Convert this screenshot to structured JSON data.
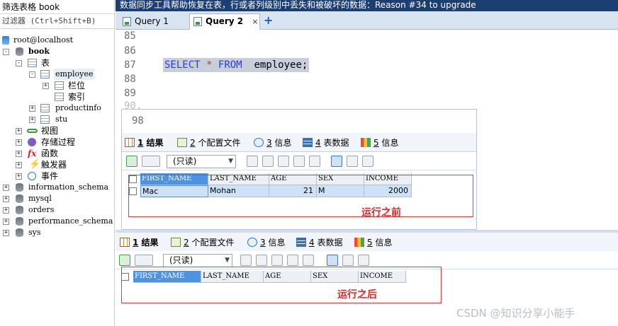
{
  "window": {
    "left_title": "筛选表格 book",
    "filter_placeholder": "过滤器 (Ctrl+Shift+B)",
    "top_message": "数据同步工具帮助恢复在表，行或者列级别中丢失和被破坏的数据：Reason #34 to upgrade"
  },
  "tree": {
    "connection": "root@localhost",
    "db_book": "book",
    "tables_folder": "表",
    "employee": "employee",
    "columns": "栏位",
    "indexes": "索引",
    "productinfo": "productinfo",
    "stu": "stu",
    "views": "视图",
    "procedures": "存储过程",
    "functions": "函数",
    "triggers": "触发器",
    "events": "事件",
    "other_dbs": [
      "information_schema",
      "mysql",
      "orders",
      "performance_schema",
      "sys"
    ]
  },
  "query_tabs": [
    {
      "label": "Query 1"
    },
    {
      "label": "Query 2",
      "close": "×"
    }
  ],
  "add_tab": "+",
  "editor": {
    "line_numbers": [
      "85",
      "86",
      "87",
      "88",
      "89",
      "90,",
      "98"
    ],
    "code": {
      "kw1": "SELECT",
      "star": "*",
      "kw2": "FROM",
      "rest": "  employee;"
    }
  },
  "result_tabs": [
    {
      "num": "1",
      "label": " 结果"
    },
    {
      "num": "2",
      "label": " 个配置文件"
    },
    {
      "num": "3",
      "label": " 信息"
    },
    {
      "num": "4",
      "label": " 表数据"
    },
    {
      "num": "5",
      "label": " 信息"
    }
  ],
  "readonly_label": "(只读)",
  "columns": [
    "FIRST_NAME",
    "LAST_NAME",
    "AGE",
    "SEX",
    "INCOME"
  ],
  "row_before": {
    "first_name": "Mac",
    "last_name": "Mohan",
    "age": "21",
    "sex": "M",
    "income": "2000"
  },
  "annotations": {
    "before": "运行之前",
    "after": "运行之后"
  },
  "watermark": "CSDN @知识分享小能手"
}
